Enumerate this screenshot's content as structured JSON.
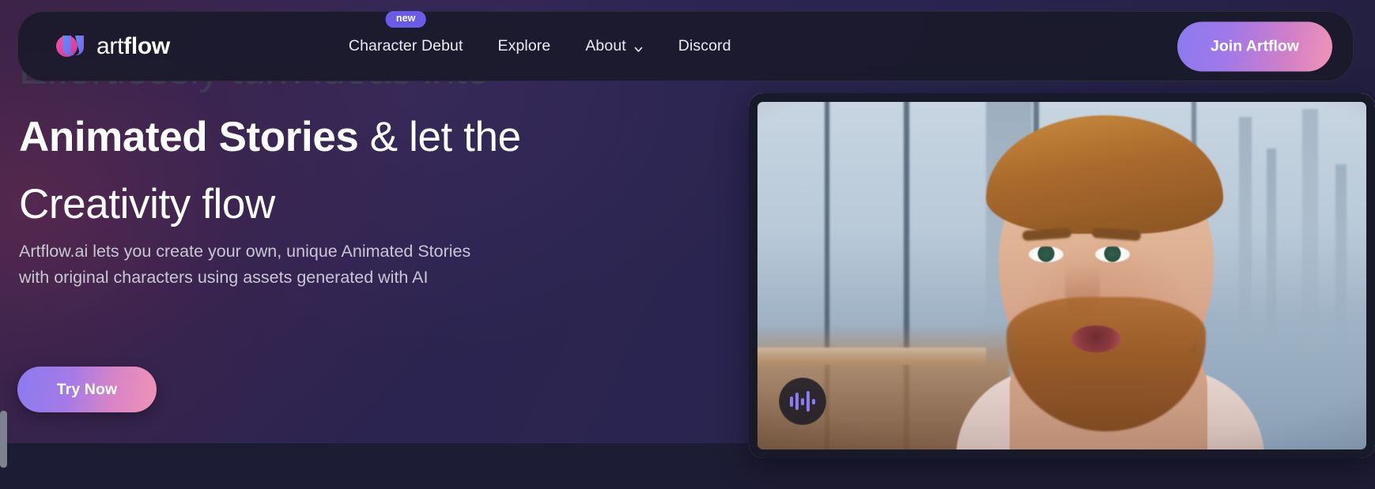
{
  "brand": {
    "name_thin": "art",
    "name_bold": "flow",
    "logo_icon": "artflow-logo-icon"
  },
  "nav": {
    "items": [
      {
        "label": "Character Debut",
        "badge": "new",
        "has_dropdown": false
      },
      {
        "label": "Explore",
        "badge": null,
        "has_dropdown": false
      },
      {
        "label": "About",
        "badge": null,
        "has_dropdown": true,
        "dropdown_icon": "chevron-down-icon"
      },
      {
        "label": "Discord",
        "badge": null,
        "has_dropdown": false
      }
    ],
    "cta": {
      "label": "Join Artflow"
    }
  },
  "hero": {
    "heading_line1": "Effortlessly turn ideas into",
    "heading_bold": "Animated Stories",
    "heading_rest": " & let the",
    "heading_line3": "Creativity flow",
    "subtitle_line1": "Artflow.ai lets you create your own, unique Animated Stories",
    "subtitle_line2": "with original characters using assets generated with AI",
    "cta": {
      "label": "Try Now"
    }
  },
  "media": {
    "audio_icon": "audio-waveform-icon",
    "alt": "AI generated bearded man speaking in an office with a city skyline"
  },
  "colors": {
    "accent_purple": "#8b7bf0",
    "accent_pink": "#ef93b5",
    "badge_purple": "#6b5ce7",
    "background_navy": "#1c1b33",
    "nav_surface": "#191a2a",
    "ghost_text": "#3e3c55",
    "body_text": "#c9c7d6"
  }
}
